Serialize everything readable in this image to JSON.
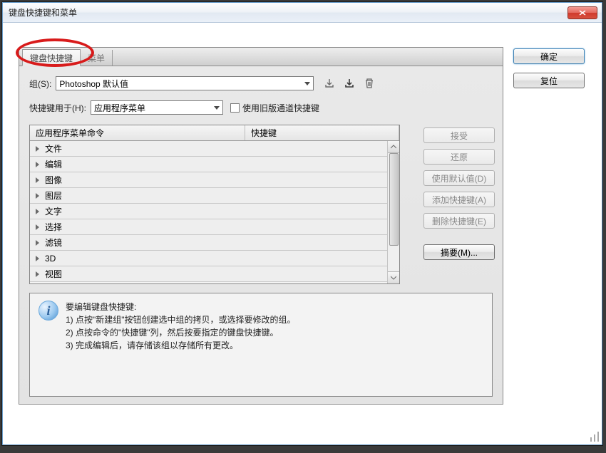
{
  "window": {
    "title": "键盘快捷键和菜单"
  },
  "tabs": {
    "t0": "键盘快捷键",
    "t1": "菜单"
  },
  "set_row": {
    "label": "组(S):",
    "value": "Photoshop 默认值"
  },
  "use_row": {
    "label": "快捷键用于(H):",
    "value": "应用程序菜单",
    "legacy_label": "使用旧版通道快捷键"
  },
  "table": {
    "col1": "应用程序菜单命令",
    "col2": "快捷键",
    "rows": [
      "文件",
      "编辑",
      "图像",
      "图层",
      "文字",
      "选择",
      "滤镜",
      "3D",
      "视图"
    ]
  },
  "side_buttons": {
    "accept": "接受",
    "undo": "还原",
    "defaults": "使用默认值(D)",
    "add": "添加快捷键(A)",
    "delete": "删除快捷键(E)",
    "summary": "摘要(M)..."
  },
  "right_buttons": {
    "ok": "确定",
    "reset": "复位"
  },
  "info": {
    "title": "要编辑键盘快捷键:",
    "l1": "1) 点按\"新建组\"按钮创建选中组的拷贝，或选择要修改的组。",
    "l2": "2) 点按命令的\"快捷键\"列，然后按要指定的键盘快捷键。",
    "l3": "3) 完成编辑后，请存储该组以存储所有更改。"
  }
}
